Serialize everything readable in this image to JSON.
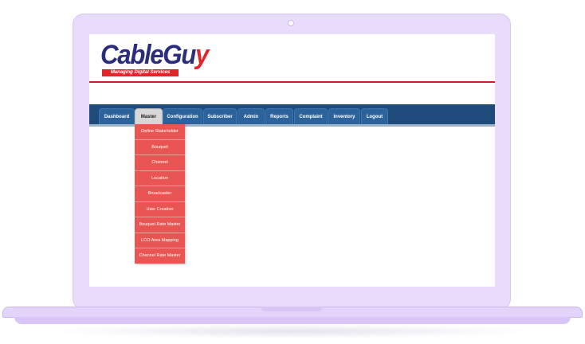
{
  "logo": {
    "text_main": "CableGu",
    "text_accent": "y",
    "tagline": "Managing Digital Services"
  },
  "nav": {
    "tabs": [
      {
        "label": "Dashboard"
      },
      {
        "label": "Master"
      },
      {
        "label": "Configuration"
      },
      {
        "label": "Subscriber"
      },
      {
        "label": "Admin"
      },
      {
        "label": "Reports"
      },
      {
        "label": "Complaint"
      },
      {
        "label": "Inventory"
      },
      {
        "label": "Logout"
      }
    ],
    "active_tab": "Master"
  },
  "master_menu": {
    "items": [
      {
        "label": "Define Stakeholder"
      },
      {
        "label": "Bouquet"
      },
      {
        "label": "Channel"
      },
      {
        "label": "Location"
      },
      {
        "label": "Broadcaster"
      },
      {
        "label": "User Creation"
      },
      {
        "label": "Bouquet Rate Master"
      },
      {
        "label": "LCO Area Mapping"
      },
      {
        "label": "Channel Rate Master"
      }
    ]
  },
  "colors": {
    "nav_bar": "#1f4b7b",
    "tab": "#2c639b",
    "active_tab": "#d8d8d8",
    "dropdown": "#e85552",
    "brand_blue": "#2b2d7a",
    "brand_red": "#e0252b",
    "laptop": "#e9dcfb"
  }
}
